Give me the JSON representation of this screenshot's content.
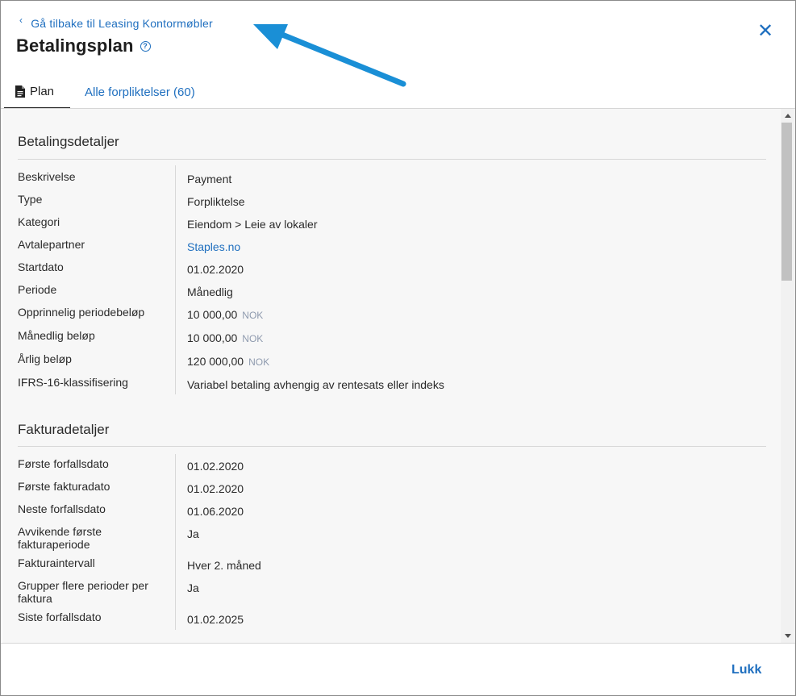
{
  "header": {
    "back_label": "Gå tilbake til Leasing Kontormøbler",
    "title": "Betalingsplan",
    "help_glyph": "?",
    "close_glyph": "✕"
  },
  "tabs": [
    {
      "label": "Plan",
      "active": true
    },
    {
      "label": "Alle forpliktelser (60)",
      "active": false
    }
  ],
  "payment_details": {
    "title": "Betalingsdetaljer",
    "rows": [
      {
        "label": "Beskrivelse",
        "value": "Payment"
      },
      {
        "label": "Type",
        "value": "Forpliktelse"
      },
      {
        "label": "Kategori",
        "value": "Eiendom > Leie av lokaler"
      },
      {
        "label": "Avtalepartner",
        "value": "Staples.no"
      },
      {
        "label": "Startdato",
        "value": "01.02.2020"
      },
      {
        "label": "Periode",
        "value": "Månedlig"
      },
      {
        "label": "Opprinnelig periodebeløp",
        "value": "10 000,00",
        "currency": "NOK"
      },
      {
        "label": "Månedlig beløp",
        "value": "10 000,00",
        "currency": "NOK"
      },
      {
        "label": "Årlig beløp",
        "value": "120 000,00",
        "currency": "NOK"
      },
      {
        "label": "IFRS-16-klassifisering",
        "value": "Variabel betaling avhengig av rentesats eller indeks"
      }
    ]
  },
  "invoice_details": {
    "title": "Fakturadetaljer",
    "rows": [
      {
        "label": "Første forfallsdato",
        "value": "01.02.2020"
      },
      {
        "label": "Første fakturadato",
        "value": "01.02.2020"
      },
      {
        "label": "Neste forfallsdato",
        "value": "01.06.2020"
      },
      {
        "label": "Avvikende første fakturaperiode",
        "value": "Ja"
      },
      {
        "label": "Fakturaintervall",
        "value": "Hver 2. måned"
      },
      {
        "label": "Grupper flere perioder per faktura",
        "value": "Ja"
      },
      {
        "label": "Siste forfallsdato",
        "value": "01.02.2025"
      }
    ]
  },
  "footer": {
    "close_label": "Lukk"
  },
  "colors": {
    "accent": "#1f6fbf",
    "annotation_arrow": "#1a8fd6"
  }
}
